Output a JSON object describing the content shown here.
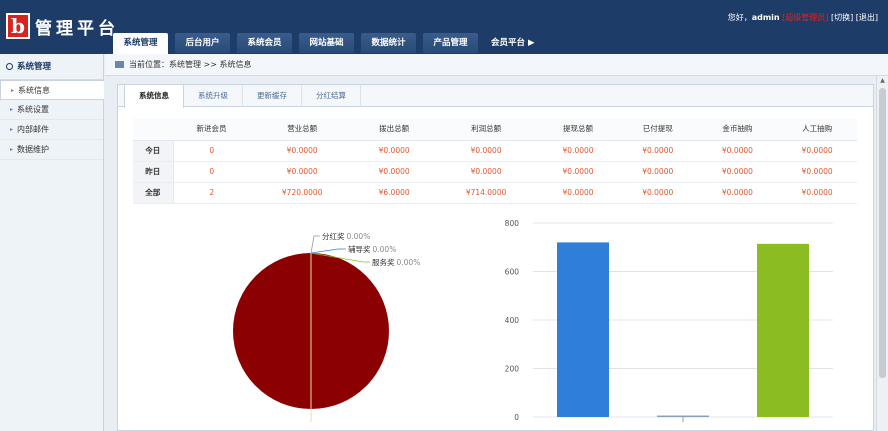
{
  "logo": {
    "mark": "b",
    "text": "管理平台"
  },
  "nav": {
    "tabs": [
      {
        "label": "系统管理",
        "active": true
      },
      {
        "label": "后台用户",
        "active": false
      },
      {
        "label": "系统会员",
        "active": false
      },
      {
        "label": "网站基础",
        "active": false
      },
      {
        "label": "数据统计",
        "active": false
      },
      {
        "label": "产品管理",
        "active": false
      }
    ],
    "more_label": "会员平台"
  },
  "userbar": {
    "greeting": "您好，",
    "username": "admin",
    "role": "[超级管理员]",
    "switch": "[切换]",
    "logout": "[退出]"
  },
  "sidebar": {
    "title": "系统管理",
    "items": [
      {
        "label": "系统信息",
        "active": true
      },
      {
        "label": "系统设置",
        "active": false
      },
      {
        "label": "内部邮件",
        "active": false
      },
      {
        "label": "数据维护",
        "active": false
      }
    ]
  },
  "breadcrumb": {
    "text": "当前位置：系统管理 >> 系统信息"
  },
  "subtabs": [
    {
      "label": "系统信息",
      "active": true
    },
    {
      "label": "系统升级",
      "active": false
    },
    {
      "label": "更新缓存",
      "active": false
    },
    {
      "label": "分红结算",
      "active": false
    }
  ],
  "stats": {
    "headers": [
      "",
      "新进会员",
      "营业总额",
      "拨出总额",
      "利润总额",
      "提现总额",
      "已付提现",
      "金币抽购",
      "人工抽购"
    ],
    "rows": [
      {
        "label": "今日",
        "values": [
          "0",
          "¥0.0000",
          "¥0.0000",
          "¥0.0000",
          "¥0.0000",
          "¥0.0000",
          "¥0.0000",
          "¥0.0000"
        ]
      },
      {
        "label": "昨日",
        "values": [
          "0",
          "¥0.0000",
          "¥0.0000",
          "¥0.0000",
          "¥0.0000",
          "¥0.0000",
          "¥0.0000",
          "¥0.0000"
        ]
      },
      {
        "label": "全部",
        "values": [
          "2",
          "¥720.0000",
          "¥6.0000",
          "¥714.0000",
          "¥0.0000",
          "¥0.0000",
          "¥0.0000",
          "¥0.0000"
        ]
      }
    ]
  },
  "chart_data": [
    {
      "type": "pie",
      "slices": [
        {
          "label": "分红奖",
          "value_label": "0.00%",
          "value": 0
        },
        {
          "label": "辅导奖",
          "value_label": "0.00%",
          "value": 0
        },
        {
          "label": "服务奖",
          "value_label": "0.00%",
          "value": 0
        },
        {
          "label": "",
          "value_label": "",
          "value": 100
        }
      ],
      "colors": [
        "#8b0000"
      ]
    },
    {
      "type": "bar",
      "categories": [
        "",
        "",
        ""
      ],
      "values": [
        720,
        6,
        714
      ],
      "colors": [
        "#2f7ed8",
        "#8aa0b8",
        "#8bbc21"
      ],
      "ylim": [
        0,
        800
      ],
      "yticks": [
        "0",
        "200",
        "400",
        "600",
        "800"
      ],
      "grid": true
    }
  ]
}
